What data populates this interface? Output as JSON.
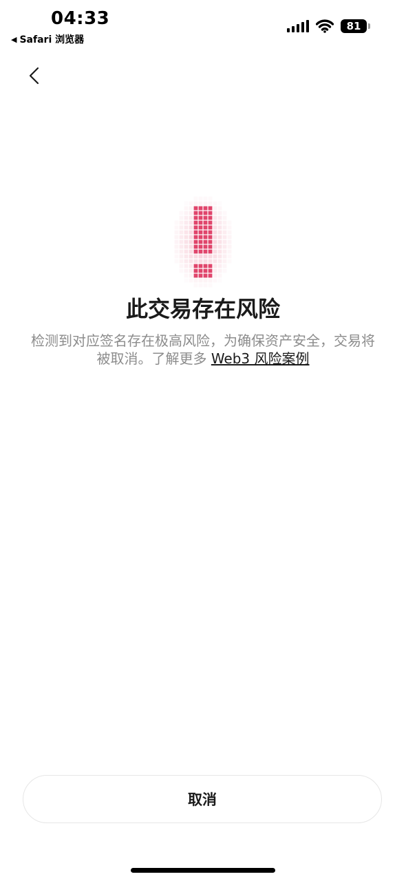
{
  "status_bar": {
    "time": "04:33",
    "back_app": "Safari 浏览器",
    "battery_level": "81",
    "icons": [
      "signal-icon",
      "wifi-icon",
      "battery-icon"
    ]
  },
  "nav": {
    "back_icon": "chevron-left-icon"
  },
  "warning": {
    "icon": "exclamation-pixel-icon",
    "color": "#e0456b",
    "title": "此交易存在风险",
    "description": "检测到对应签名存在极高风险，为确保资产安全，交易将被取消。了解更多",
    "link_text": "Web3 风险案例"
  },
  "actions": {
    "cancel_label": "取消"
  },
  "colors": {
    "background": "#ffffff",
    "title": "#1a1a1a",
    "description": "#8c8c8c",
    "accent": "#e0456b",
    "button_border": "#e6e6e6"
  }
}
